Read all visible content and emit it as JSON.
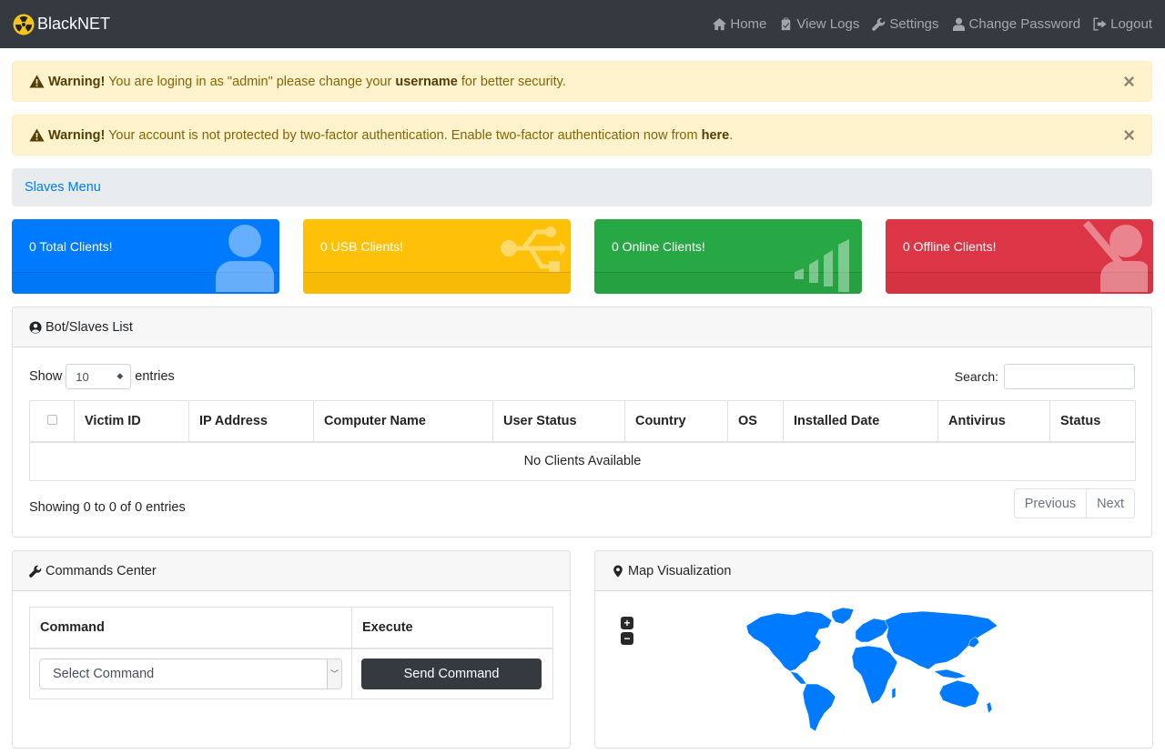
{
  "brand": {
    "name": "BlackNET"
  },
  "nav": [
    {
      "label": "Home",
      "icon": "home-icon"
    },
    {
      "label": "View Logs",
      "icon": "clipboard-icon"
    },
    {
      "label": "Settings",
      "icon": "wrench-icon"
    },
    {
      "label": "Change Password",
      "icon": "user-icon"
    },
    {
      "label": "Logout",
      "icon": "sign-out-icon"
    }
  ],
  "alerts": [
    {
      "strong": "Warning!",
      "text_before": " You are loging in as \"admin\" please change your ",
      "bold": "username",
      "text_after": " for better security.",
      "close": "×"
    },
    {
      "strong": "Warning!",
      "text_before": " Your account is not protected by two-factor authentication. Enable two-factor authentication now from ",
      "bold": "here",
      "text_after": ".",
      "close": "×"
    }
  ],
  "breadcrumb": {
    "label": "Slaves Menu"
  },
  "stats": [
    {
      "label": "0 Total Clients!",
      "color": "#007bff",
      "icon": "user-icon"
    },
    {
      "label": "0 USB Clients!",
      "color": "#ffc107",
      "icon": "usb-icon"
    },
    {
      "label": "0 Online Clients!",
      "color": "#28a745",
      "icon": "signal-icon"
    },
    {
      "label": "0 Offline Clients!",
      "color": "#dc3545",
      "icon": "user-slash-icon"
    }
  ],
  "slaves": {
    "title": "Bot/Slaves List",
    "show_label": "Show",
    "page_size": "10",
    "entries_label": "entries",
    "search_label": "Search:",
    "columns": [
      "Victim ID",
      "IP Address",
      "Computer Name",
      "User Status",
      "Country",
      "OS",
      "Installed Date",
      "Antivirus",
      "Status"
    ],
    "empty": "No Clients Available",
    "showing": "Showing 0 to 0 of 0 entries",
    "prev": "Previous",
    "next": "Next"
  },
  "commands": {
    "title": "Commands Center",
    "col_command": "Command",
    "col_execute": "Execute",
    "select_value": "Select Command",
    "button": "Send Command"
  },
  "map": {
    "title": "Map Visualization",
    "zoom_in": "+",
    "zoom_out": "−",
    "fill_color": "#007bff"
  }
}
